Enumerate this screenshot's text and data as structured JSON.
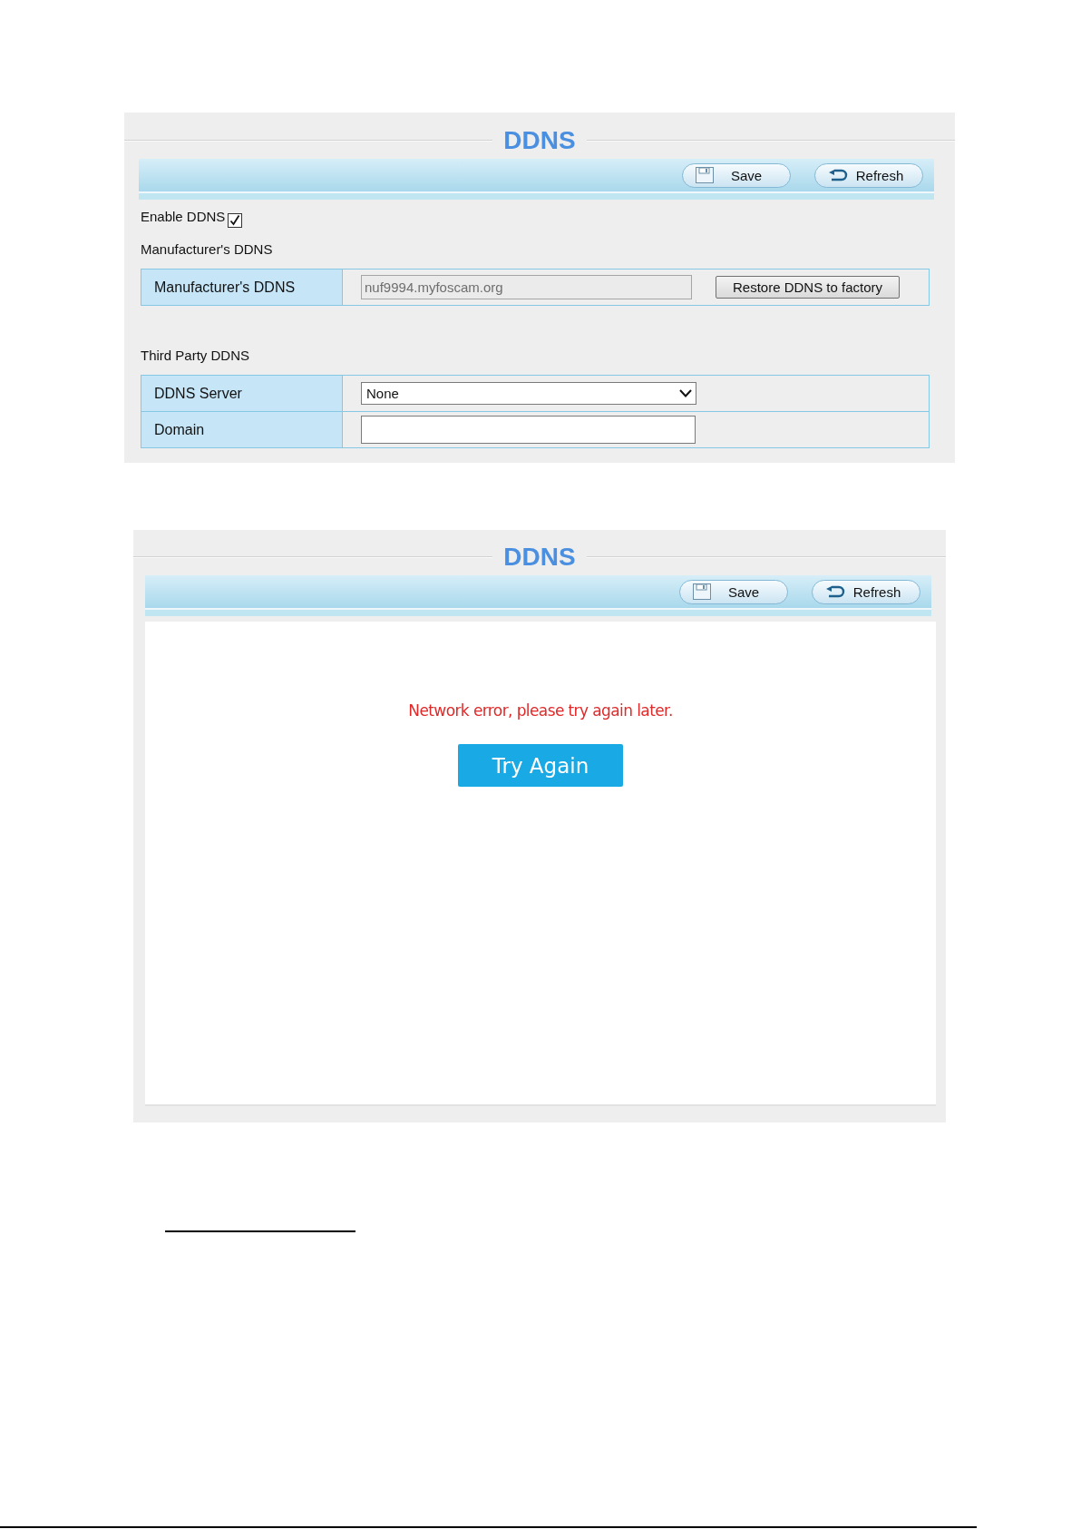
{
  "settings_panel": {
    "title": "DDNS",
    "toolbar": [
      {
        "kind": "save",
        "label": "Save"
      },
      {
        "kind": "refresh",
        "label": "Refresh"
      }
    ],
    "enable": {
      "label": "Enable DDNS",
      "checked": true
    },
    "sections": [
      {
        "heading": "Manufacturer's DDNS",
        "rows": [
          {
            "kind": "readonly",
            "label": "Manufacturer's DDNS",
            "value": "nuf9994.myfoscam.org",
            "button": "Restore DDNS to factory"
          }
        ]
      },
      {
        "heading": "Third Party DDNS",
        "rows": [
          {
            "kind": "select",
            "label": "DDNS Server",
            "value": "None"
          },
          {
            "kind": "input",
            "label": "Domain"
          }
        ]
      }
    ]
  },
  "error_panel": {
    "title": "DDNS",
    "toolbar": [
      {
        "kind": "save",
        "label": "Save"
      },
      {
        "kind": "refresh",
        "label": "Refresh"
      }
    ],
    "message": "Network error, please try again later.",
    "button": "Try Again"
  }
}
